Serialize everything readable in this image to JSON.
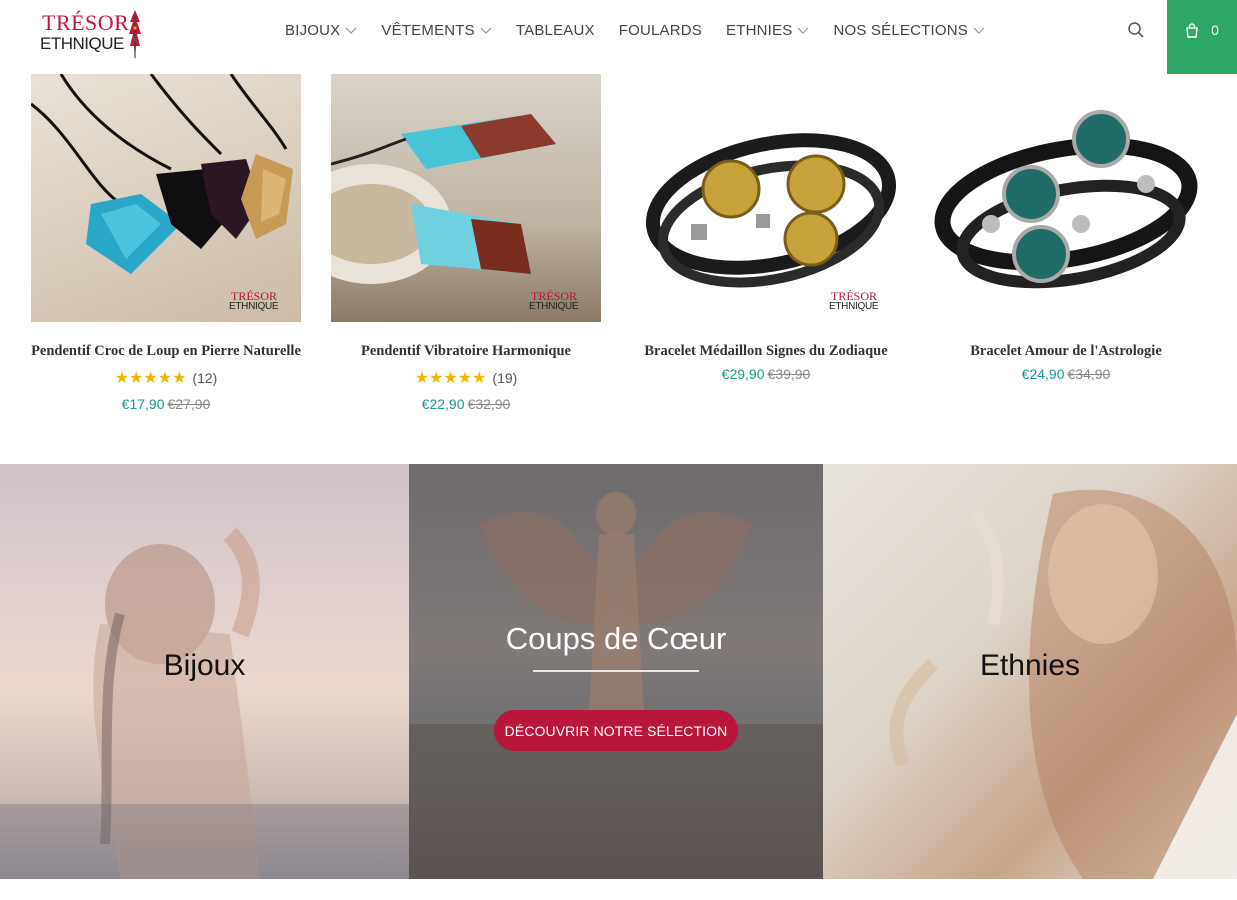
{
  "header": {
    "logo_line1": "TRÉSOR",
    "logo_line2": "ETHNIQUE",
    "nav": [
      {
        "label": "BIJOUX",
        "has_dropdown": true
      },
      {
        "label": "VÊTEMENTS",
        "has_dropdown": true
      },
      {
        "label": "TABLEAUX",
        "has_dropdown": false
      },
      {
        "label": "FOULARDS",
        "has_dropdown": false
      },
      {
        "label": "ETHNIES",
        "has_dropdown": true
      },
      {
        "label": "NOS SÉLECTIONS",
        "has_dropdown": true
      }
    ],
    "search_icon": "search-icon",
    "cart_icon": "shopping-bag-icon",
    "cart_count": "0"
  },
  "watermark": {
    "line1": "TRÉSOR",
    "line2": "ETHNIQUE"
  },
  "products": [
    {
      "title": "Pendentif Croc de Loup en Pierre Naturelle",
      "stars": "★★★★★",
      "reviews": "(12)",
      "price": "€17,90",
      "compare_price": "€27,90",
      "has_watermark": true
    },
    {
      "title": "Pendentif Vibratoire Harmonique",
      "stars": "★★★★★",
      "reviews": "(19)",
      "price": "€22,90",
      "compare_price": "€32,90",
      "has_watermark": true
    },
    {
      "title": "Bracelet Médaillon Signes du Zodiaque",
      "stars": "",
      "reviews": "",
      "price": "€29,90",
      "compare_price": "€39,90",
      "has_watermark": true
    },
    {
      "title": "Bracelet Amour de l'Astrologie",
      "stars": "",
      "reviews": "",
      "price": "€24,90",
      "compare_price": "€34,90",
      "has_watermark": false
    }
  ],
  "banners": {
    "left": {
      "label": "Bijoux"
    },
    "center": {
      "label": "Coups de Cœur",
      "cta": "DÉCOUVRIR NOTRE SÉLECTION"
    },
    "right": {
      "label": "Ethnies"
    }
  },
  "colors": {
    "accent_green": "#2fa764",
    "brand_red": "#b8163a",
    "price_teal": "#1e9a8f",
    "star_gold": "#f5b400"
  }
}
